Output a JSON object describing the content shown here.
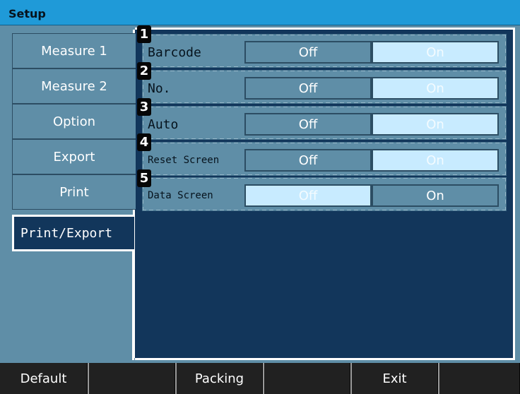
{
  "window": {
    "title": "Setup"
  },
  "tabs": [
    {
      "label": "Measure 1"
    },
    {
      "label": "Measure 2"
    },
    {
      "label": "Option"
    },
    {
      "label": "Export"
    },
    {
      "label": "Print"
    }
  ],
  "active_tab": {
    "label": "Print/Export"
  },
  "settings": [
    {
      "number": "1",
      "label": "Barcode",
      "off_label": "Off",
      "on_label": "On",
      "selected": "On"
    },
    {
      "number": "2",
      "label": "No.",
      "off_label": "Off",
      "on_label": "On",
      "selected": "On"
    },
    {
      "number": "3",
      "label": "Auto",
      "off_label": "Off",
      "on_label": "On",
      "selected": "On"
    },
    {
      "number": "4",
      "label": "Reset Screen",
      "off_label": "Off",
      "on_label": "On",
      "selected": "On"
    },
    {
      "number": "5",
      "label": "Data Screen",
      "off_label": "Off",
      "on_label": "On",
      "selected": "Off"
    }
  ],
  "footer": {
    "buttons": [
      {
        "label": "Default"
      },
      {
        "label": ""
      },
      {
        "label": "Packing"
      },
      {
        "label": ""
      },
      {
        "label": "Exit"
      },
      {
        "label": ""
      }
    ]
  },
  "colors": {
    "title_bar": "#1f9ad8",
    "panel": "#5f8ea7",
    "content": "#12365b",
    "selected": "#c8ebff"
  }
}
